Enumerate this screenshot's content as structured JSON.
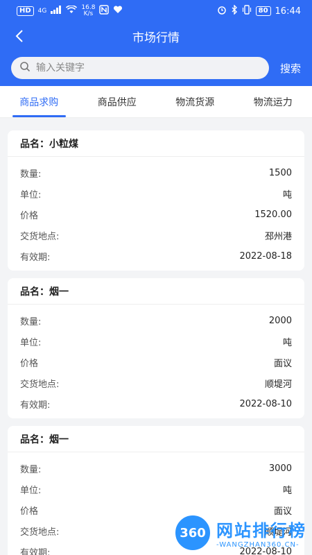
{
  "status": {
    "left_badges": [
      "HD",
      "4G"
    ],
    "speed_top": "16.8",
    "speed_bottom": "K/s",
    "battery": "80",
    "time": "16:44"
  },
  "header": {
    "title": "市场行情"
  },
  "search": {
    "placeholder": "输入关键字",
    "value": "",
    "button": "搜索"
  },
  "tabs": [
    {
      "label": "商品求购",
      "active": true
    },
    {
      "label": "商品供应",
      "active": false
    },
    {
      "label": "物流货源",
      "active": false
    },
    {
      "label": "物流运力",
      "active": false
    }
  ],
  "labels": {
    "name": "品名：",
    "quantity": "数量:",
    "unit": "单位:",
    "price": "价格",
    "location": "交货地点:",
    "validity": "有效期:"
  },
  "cards": [
    {
      "name": "小粒煤",
      "quantity": "1500",
      "unit": "吨",
      "price": "1520.00",
      "location": "邳州港",
      "validity": "2022-08-18"
    },
    {
      "name": "烟一",
      "quantity": "2000",
      "unit": "吨",
      "price": "面议",
      "location": "顺堤河",
      "validity": "2022-08-10"
    },
    {
      "name": "烟一",
      "quantity": "3000",
      "unit": "吨",
      "price": "面议",
      "location": "顺堤河",
      "validity": "2022-08-10"
    }
  ],
  "watermark": {
    "logo": "360",
    "title": "网站排行榜",
    "sub": "-WANGZHAN360.CN-"
  },
  "colors": {
    "primary": "#2f6cf5",
    "watermark": "#1a8cff"
  }
}
